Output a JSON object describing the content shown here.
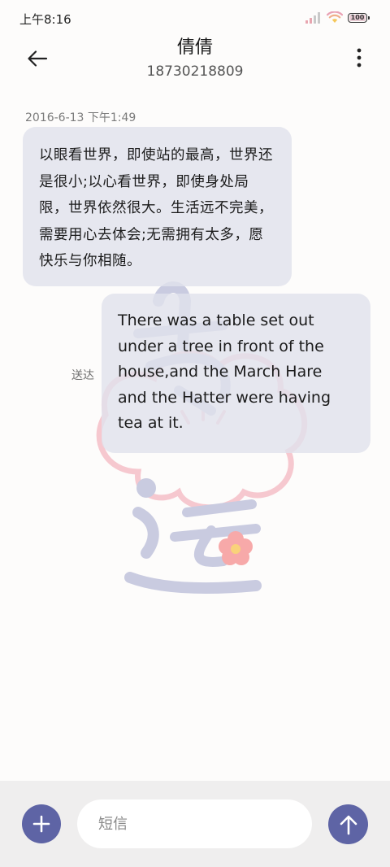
{
  "status_bar": {
    "time": "上午8:16",
    "battery": "100",
    "battery_level": 1.0,
    "icons": [
      "signal-icon",
      "wifi-icon",
      "battery-icon"
    ]
  },
  "header": {
    "contact_name": "倩倩",
    "contact_number": "18730218809",
    "back_icon": "arrow-left-icon",
    "more_icon": "more-vertical-icon"
  },
  "conversation": {
    "timestamp": "2016-6-13 下午1:49",
    "incoming_message": "以眼看世界，即使站的最高，世界还是很小;以心看世界，即使身处局限，世界依然很大。生活远不完美，需要用心去体会;无需拥有太多，愿快乐与你相随。",
    "outgoing_message": "There was a table set out under a tree in front of the house,and the March Hare and the Hatter were having tea at it.",
    "outgoing_status": "送达"
  },
  "composer": {
    "placeholder": "短信",
    "value": "",
    "add_icon": "plus-icon",
    "send_icon": "arrow-up-icon"
  },
  "colors": {
    "accent": "#5e64a5",
    "bubble": "#e0e2ec",
    "composer_bg": "#efeeee",
    "page_bg": "#fdfcfb"
  }
}
